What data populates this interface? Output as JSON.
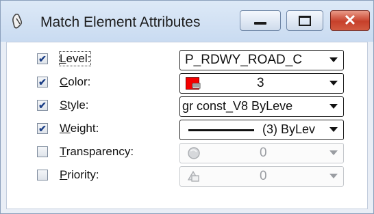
{
  "window": {
    "title": "Match Element Attributes"
  },
  "caption_buttons": {
    "minimize": "—",
    "maximize": "□",
    "close": "✕"
  },
  "rows": [
    {
      "label_first": "L",
      "label_rest": "evel:",
      "checked": true,
      "value": "P_RDWY_ROAD_C",
      "disabled": false
    },
    {
      "label_first": "C",
      "label_rest": "olor:",
      "checked": true,
      "value": "3",
      "disabled": false,
      "swatch_color": "#f40000"
    },
    {
      "label_first": "S",
      "label_rest": "tyle:",
      "checked": true,
      "value": "gr const_V8  ByLeve",
      "disabled": false
    },
    {
      "label_first": "W",
      "label_rest": "eight:",
      "checked": true,
      "value": "(3) ByLev",
      "disabled": false
    },
    {
      "label_first": "T",
      "label_rest": "ransparency:",
      "checked": false,
      "value": "0",
      "disabled": true
    },
    {
      "label_first": "P",
      "label_rest": "riority:",
      "checked": false,
      "value": "0",
      "disabled": true
    }
  ],
  "check_glyph": "✔"
}
